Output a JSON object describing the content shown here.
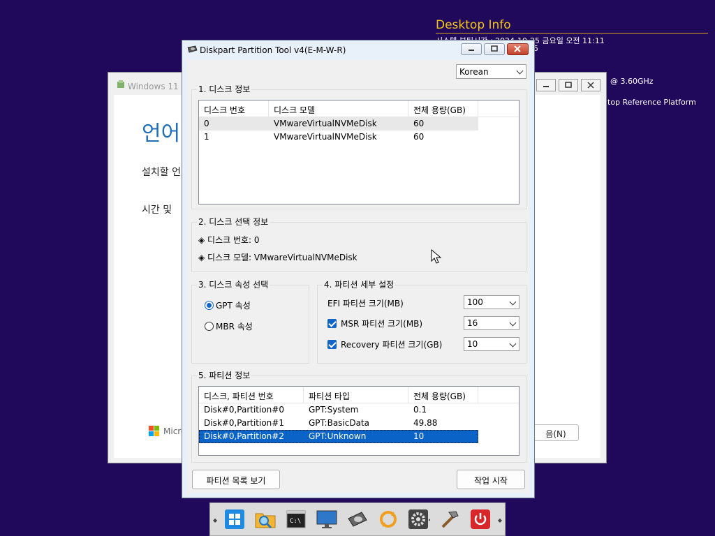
{
  "desktop_info": {
    "title": "Desktop Info",
    "lines": {
      "boot": "시스템 부팅시간 : 2024-10-25 금요일 오전 11:11",
      "boot2": "25",
      "cpu": "@ 3.60GHz",
      "platform": "top Reference Platform"
    }
  },
  "bg_window": {
    "title": "Windows 11 설",
    "heading": "언어",
    "line1": "설치할 언",
    "line2": "시간 및 ",
    "brand": "Micros",
    "next_label": "음(N)"
  },
  "tool": {
    "title": "Diskpart Partition Tool v4(E-M-W-R)",
    "language": "Korean",
    "disk_info": {
      "title": "1. 디스크 정보",
      "headers": [
        "디스크 번호",
        "디스크 모델",
        "전체 용량(GB)"
      ],
      "rows": [
        {
          "num": "0",
          "model": "VMwareVirtualNVMeDisk",
          "size": "60"
        },
        {
          "num": "1",
          "model": "VMwareVirtualNVMeDisk",
          "size": "60"
        }
      ]
    },
    "selection": {
      "title": "2. 디스크 선택 정보",
      "disk_no": "◈ 디스크 번호: 0",
      "disk_model": "◈ 디스크 모델: VMwareVirtualNVMeDisk"
    },
    "attribute": {
      "title": "3. 디스크 속성 선택",
      "gpt": "GPT 속성",
      "mbr": "MBR 속성"
    },
    "partition_settings": {
      "title": "4. 파티션 세부 설정",
      "efi_label": "EFI 파티션 크기(MB)",
      "efi_value": "100",
      "msr_label": "MSR 파티션 크기(MB)",
      "msr_value": "16",
      "recovery_label": "Recovery 파티션 크기(GB)",
      "recovery_value": "10"
    },
    "partition_info": {
      "title": "5. 파티션 정보",
      "headers": [
        "디스크, 파티션 번호",
        "파티션 타입",
        "전체 용량(GB)"
      ],
      "rows": [
        {
          "id": "Disk#0,Partition#0",
          "type": "GPT:System",
          "size": "0.1"
        },
        {
          "id": "Disk#0,Partition#1",
          "type": "GPT:BasicData",
          "size": "49.88"
        },
        {
          "id": "Disk#0,Partition#2",
          "type": "GPT:Unknown",
          "size": "10"
        }
      ]
    },
    "buttons": {
      "view_list": "파티션 목록 보기",
      "start": "작업 시작"
    }
  },
  "taskbar": {
    "icons": [
      "windows-start-icon",
      "file-explorer-icon",
      "command-prompt-icon",
      "monitor-icon",
      "hard-disk-icon",
      "sync-icon",
      "settings-gear-icon",
      "tools-hammer-icon",
      "power-icon"
    ]
  }
}
